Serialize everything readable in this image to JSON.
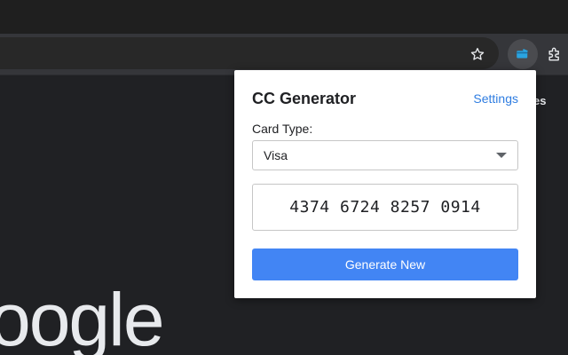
{
  "browser": {
    "toolbar": {
      "bookmark_icon": "star-icon",
      "active_extension_icon": "card-icon",
      "extensions_menu_icon": "puzzle-icon"
    },
    "page": {
      "partial_link_text": "es",
      "logo_fragment": "oogle"
    }
  },
  "popup": {
    "title": "CC Generator",
    "settings_label": "Settings",
    "card_type": {
      "label": "Card Type:",
      "selected": "Visa"
    },
    "card_number": "4374 6724 8257 0914",
    "generate_label": "Generate New"
  },
  "colors": {
    "accent": "#4285f4",
    "link": "#2f7de1",
    "extension_icon": "#2aa4e0",
    "browser_frame": "#35363a"
  }
}
